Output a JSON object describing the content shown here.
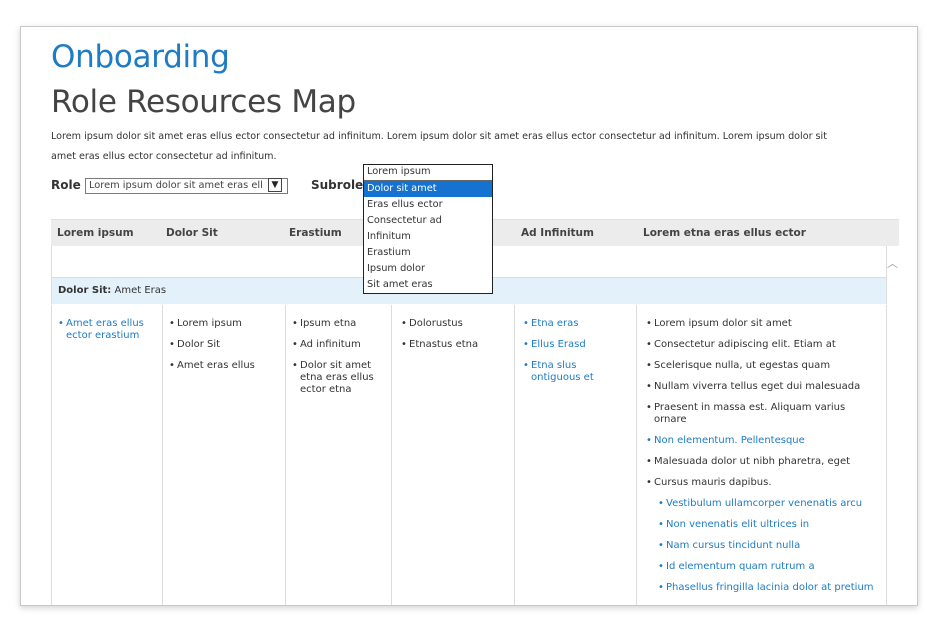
{
  "header": {
    "app_title": "Onboarding",
    "page_title": "Role Resources Map",
    "description": "Lorem ipsum dolor sit amet eras ellus ector consectetur ad infinitum. Lorem ipsum dolor sit amet eras ellus ector consectetur ad infinitum. Lorem ipsum dolor sit amet eras ellus ector consectetur ad infinitum."
  },
  "filters": {
    "role_label": "Role",
    "role_value": "Lorem ipsum dolor sit amet eras ell",
    "subrole_label": "Subrole",
    "subrole_value": "Lorem ipsum",
    "subrole_options": [
      "Dolor sit amet",
      "Eras ellus ector",
      "Consectetur ad",
      "Infinitum",
      "Erastium",
      "Ipsum dolor",
      "Sit amet eras"
    ],
    "subrole_selected_index": 0
  },
  "table": {
    "columns": [
      "Lorem ipsum",
      "Dolor Sit",
      "Erastium",
      "",
      "Ad Infinitum",
      "Lorem etna eras ellus ector"
    ],
    "group": {
      "label": "Dolor Sit:",
      "value": "Amet Eras"
    },
    "cells": [
      [
        {
          "text": "Amet eras ellus ector erastium",
          "link": true
        }
      ],
      [
        {
          "text": "Lorem ipsum"
        },
        {
          "text": "Dolor Sit"
        },
        {
          "text": "Amet eras ellus"
        }
      ],
      [
        {
          "text": "Ipsum etna"
        },
        {
          "text": "Ad infinitum"
        },
        {
          "text": "Dolor sit amet etna eras ellus ector etna"
        }
      ],
      [
        {
          "text": "Dolorustus"
        },
        {
          "text": "Etnastus etna"
        }
      ],
      [
        {
          "text": "Etna eras",
          "link": true
        },
        {
          "text": "Ellus Erasd",
          "link": true
        },
        {
          "text": "Etna slus ontiguous et",
          "link": true
        }
      ],
      [
        {
          "text": "Lorem ipsum dolor sit amet"
        },
        {
          "text": "Consectetur adipiscing elit. Etiam at"
        },
        {
          "text": "Scelerisque nulla, ut egestas quam"
        },
        {
          "text": "Nullam viverra tellus eget dui malesuada"
        },
        {
          "text": "Praesent in massa est. Aliquam varius ornare"
        },
        {
          "text": "Non elementum. Pellentesque",
          "link": true
        },
        {
          "text": "Malesuada dolor ut nibh pharetra, eget"
        },
        {
          "text": "Cursus mauris dapibus."
        },
        {
          "text": "Vestibulum ullamcorper venenatis arcu",
          "link": true,
          "sub": true
        },
        {
          "text": "Non venenatis elit ultrices in",
          "link": true,
          "sub": true
        },
        {
          "text": "Nam cursus tincidunt nulla",
          "link": true,
          "sub": true
        },
        {
          "text": "Id elementum quam rutrum a",
          "link": true,
          "sub": true
        },
        {
          "text": "Phasellus fringilla lacinia dolor at pretium",
          "link": true,
          "sub": true
        }
      ]
    ]
  },
  "icons": {
    "dropdown": "chevron-down-icon",
    "scroll_up": "chevron-up-icon"
  },
  "colors": {
    "accent": "#1e7bc4",
    "header_bg": "#ececec",
    "group_bg": "#e2f1fa",
    "selection": "#1572d0"
  }
}
